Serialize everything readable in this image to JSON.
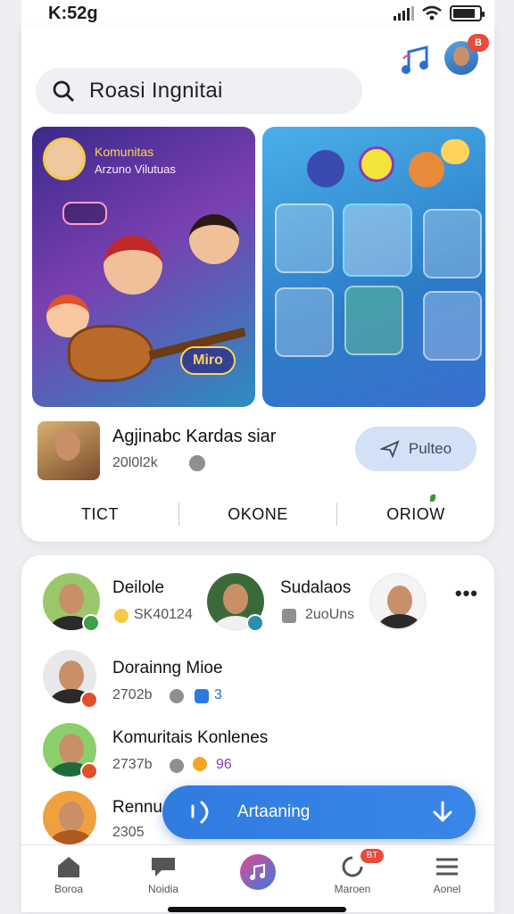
{
  "status_bar": {
    "time": "K:52g"
  },
  "header": {
    "avatar_badge": "B"
  },
  "search": {
    "text": "Roasi Ingnitai"
  },
  "featured": {
    "left_banner": {
      "title": "Komunitas",
      "subtitle": "Arzuno Vilutuas",
      "chip_label": "Miro"
    },
    "right_banner": {
      "tile_label": ""
    }
  },
  "profile": {
    "name": "Agjinabc Kardas siar",
    "stat": "20l0l2k",
    "follow_label": "Pulteo"
  },
  "tabs": [
    "TICT",
    "OKONE",
    "ORIOW"
  ],
  "friends": [
    {
      "name": "Deilole",
      "meta": "SK40124",
      "badge_color": "#3aa04a"
    },
    {
      "name": "Sudalaos",
      "meta": "2uoUns",
      "badge_color": "#2a8fa8"
    },
    {
      "name": "",
      "meta": "",
      "badge_color": ""
    }
  ],
  "list": [
    {
      "name": "Dorainng Mioe",
      "meta": "2702b",
      "meta2": "3",
      "badge_color": "#e0502a"
    },
    {
      "name": "Komuritais Konlenes",
      "meta": "2737b",
      "meta2": "96",
      "badge_color": "#e0502a"
    },
    {
      "name": "Rennu",
      "meta": "2305",
      "meta2": "",
      "badge_color": "#e0502a"
    }
  ],
  "now_playing": {
    "label": "Artaaning"
  },
  "tab_bar": [
    {
      "label": "Boroa",
      "icon": "home-icon"
    },
    {
      "label": "Noidia",
      "icon": "chat-icon"
    },
    {
      "label": "",
      "icon": "music-note-icon"
    },
    {
      "label": "Maroen",
      "icon": "notification-icon",
      "badge": "BT"
    },
    {
      "label": "Aonel",
      "icon": "menu-icon"
    }
  ],
  "colors": {
    "accent": "#2f7be0",
    "badge": "#e74c3c",
    "follow_bg": "#d2e1f6"
  }
}
